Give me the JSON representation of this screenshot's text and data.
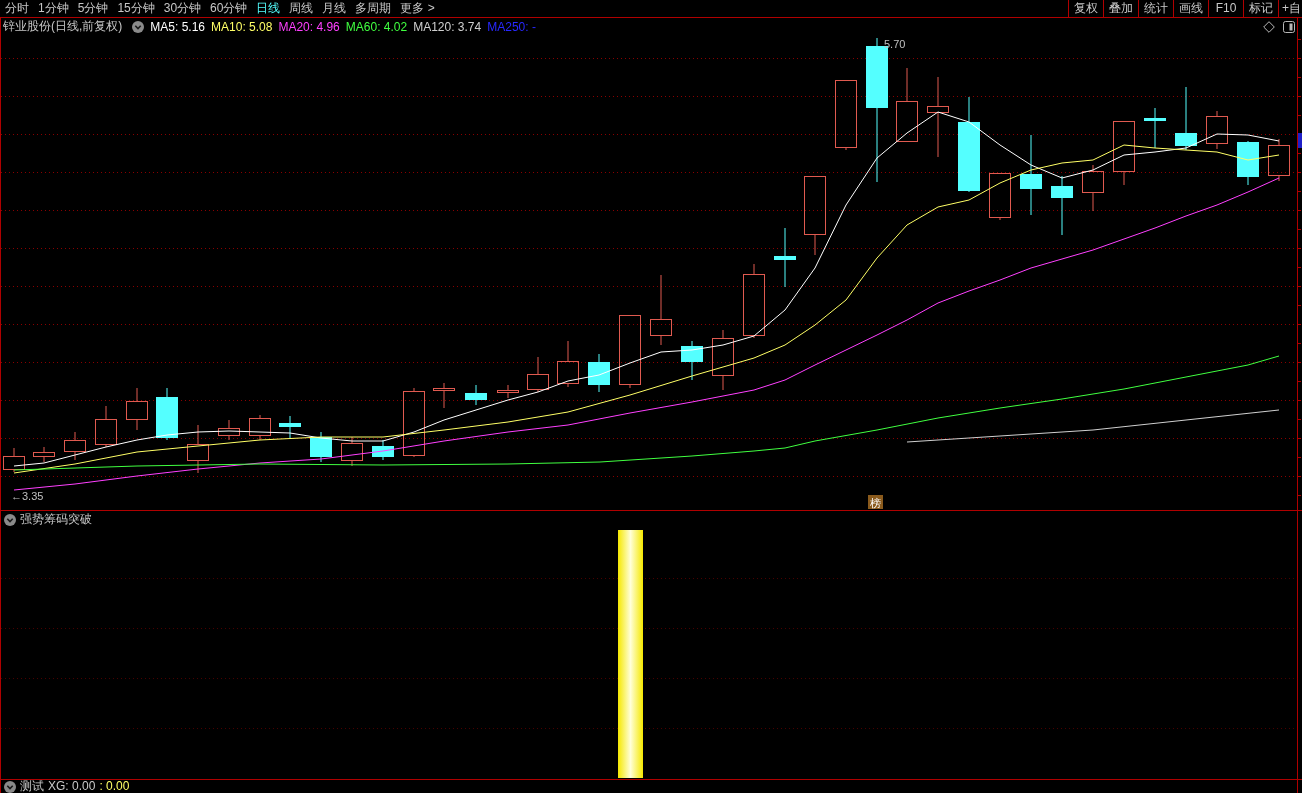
{
  "toolbar": {
    "period_tabs": [
      {
        "label": "分时",
        "selected": false
      },
      {
        "label": "1分钟",
        "selected": false
      },
      {
        "label": "5分钟",
        "selected": false
      },
      {
        "label": "15分钟",
        "selected": false
      },
      {
        "label": "30分钟",
        "selected": false
      },
      {
        "label": "60分钟",
        "selected": false
      },
      {
        "label": "日线",
        "selected": true
      },
      {
        "label": "周线",
        "selected": false
      },
      {
        "label": "月线",
        "selected": false
      },
      {
        "label": "多周期",
        "selected": false
      },
      {
        "label": "更多 >",
        "selected": false
      }
    ],
    "tools": [
      "复权",
      "叠加",
      "统计",
      "画线",
      "F10",
      "标记",
      "+自"
    ]
  },
  "main_chart": {
    "title": "锌业股份(日线,前复权)",
    "indicators": [
      {
        "label": "MA5: 5.16",
        "color": "#ffffff"
      },
      {
        "label": "MA10: 5.08",
        "color": "#ffff66"
      },
      {
        "label": "MA20: 4.96",
        "color": "#ff40ff"
      },
      {
        "label": "MA60: 4.02",
        "color": "#40ff40"
      },
      {
        "label": "MA120: 3.74",
        "color": "#d0d0d0"
      },
      {
        "label": "MA250: -",
        "color": "#2828ff"
      }
    ],
    "high_label": "5.70",
    "low_label": "←3.35",
    "badge": "榜"
  },
  "indicator_pane": {
    "title": "强势筹码突破"
  },
  "bottom_pane": {
    "title": "测试",
    "values": [
      {
        "text": "XG: 0.00",
        "color": "#c8c8c8"
      },
      {
        "text": ": 0.00",
        "color": "#ffff66"
      }
    ]
  }
}
